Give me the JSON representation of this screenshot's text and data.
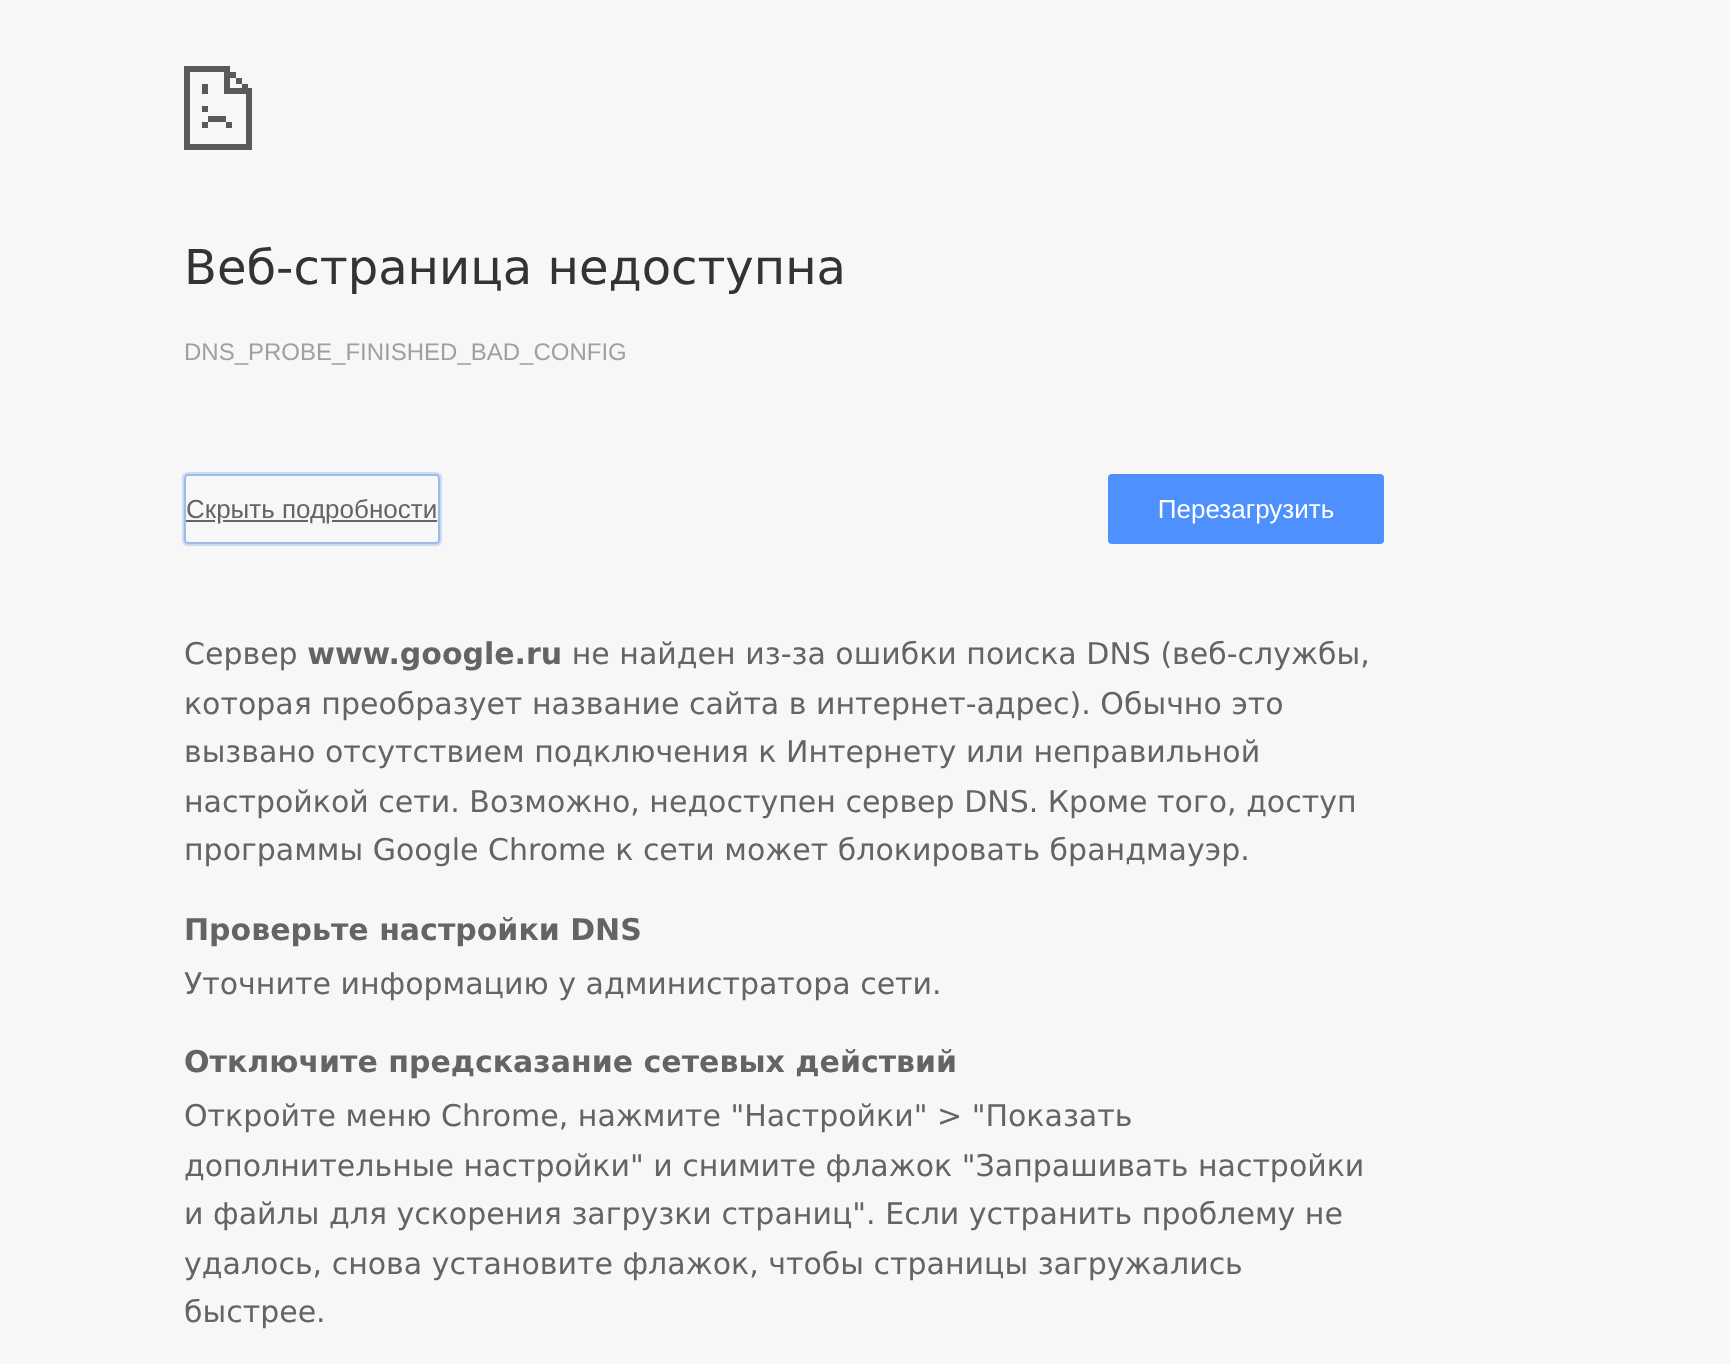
{
  "heading": "Веб-страница недоступна",
  "error_code": "DNS_PROBE_FINISHED_BAD_CONFIG",
  "details_button": {
    "label": "Скрыть подробности",
    "focused": true
  },
  "reload_button": {
    "label": "Перезагрузить"
  },
  "summary": "Сервер **www.google.ru** не найден из-за ошибки поиска DNS (веб-службы, которая преобразует название сайта в интернет-адрес). Обычно это вызвано отсутствием подключения к Интернету или неправильной настройкой сети. Возможно, недоступен сервер DNS. Кроме того, доступ программы Google Chrome к сети может блокировать брандмауэр.",
  "suggestions": [
    {
      "title": "Проверьте настройки DNS",
      "body": "Уточните информацию у администратора сети."
    },
    {
      "title": "Отключите предсказание сетевых действий",
      "body": "Откройте меню Chrome, нажмите \"Настройки\" > \"Показать дополнительные настройки\" и снимите флажок \"Запрашивать настройки и файлы для ускорения загрузки страниц\". Если устранить проблему не удалось, снова установите флажок, чтобы страницы загружались быстрее."
    }
  ]
}
